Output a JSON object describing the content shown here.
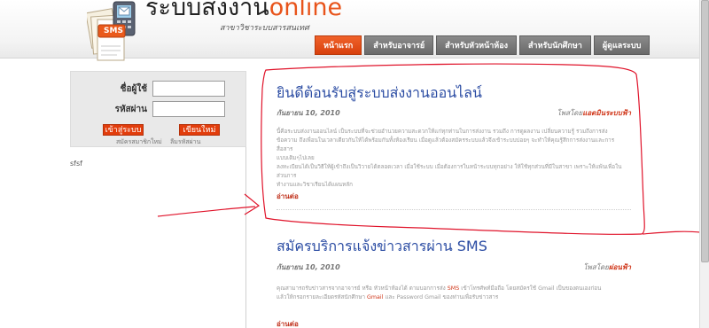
{
  "header": {
    "title_main": "ระบบส่งงาน",
    "title_accent": "online",
    "subtitle": "สาขาวิชาระบบสารสนเทศ",
    "logo_badge": "SMS"
  },
  "nav": {
    "items": [
      {
        "label": "หน้าแรก",
        "active": true
      },
      {
        "label": "สำหรับอาจารย์",
        "active": false
      },
      {
        "label": "สำหรับหัวหน้าห้อง",
        "active": false
      },
      {
        "label": "สำหรับนักศึกษา",
        "active": false
      },
      {
        "label": "ผู้ดูแลระบบ",
        "active": false
      }
    ]
  },
  "login": {
    "username_label": "ชื่อผู้ใช้",
    "username_value": "",
    "password_label": "รหัสผ่าน",
    "password_value": "",
    "login_button": "เข้าสู่ระบบ",
    "register_button": "เขียนใหม่",
    "signup_link": "สมัครสมาชิกใหม่",
    "forgot_link": "ลืมรหัสผ่าน"
  },
  "sidebar": {
    "extra_text": "sfsf"
  },
  "posts": [
    {
      "title": "ยินดีต้อนรับสู่ระบบส่งงานออนไลน์",
      "date": "กันยายน 10, 2010",
      "author_prefix": "โพสโดย",
      "author_name": "แอดมินระบบฟ้า",
      "body_line1": "นี้คือระบบส่งงานออนไลน์ เป็นระบบที่จะช่วยอำนวยความสะดวกให้แก่ทุกท่านในการส่งงาน รวมถึง การดูผลงาน เปลี่ยนความรู้ รวมถึงการส่ง",
      "body_line2": "ข้อความ ถึงเพื่อนในเวลาเดียวกันให้ได้พร้อมกันทั้งห้องเรียน เมื่อดูแล้วต้องสมัครระบบแล้วจึงเข้าระบบบ่อยๆ จะทำให้คุณรู้สึกการส่งงานและการสื่อสาร",
      "body_line3": "แบบเดิมๆไปเลย",
      "body_line4": "ลงทะเบียนได้เป็นวิธีให้ผู้เข้าถึงเป็นวิวายได้ตลอดเวลา เมื่อใช้ระบบ เมื่อต้องการในหน้าระบบทุกอย่าง ให้ใช้ทุกส่วนที่มีในสาขา เพราะให้แพ้นเพื่อในส่วนการ",
      "body_line5": "ทำงานและวิชาเรียนได้แผนหลัก",
      "read_more": "อ่านต่อ"
    },
    {
      "title": "สมัครบริการแจ้งข่าวสารผ่าน SMS",
      "date": "กันยายน 10, 2010",
      "author_prefix": "โพสโดย",
      "author_name": "ผ่อนฟ้า",
      "body_line1_a": "คุณสามารถรับข่าวสารจากอาจารย์ หรือ หัวหน้าห้องได้ ตามบอกการส่ง",
      "body_line1_hl": "SMS",
      "body_line1_b": "เข้าโทรศัพท์มือถือ โดยสมัครใช้ Gmail เป็นของตนเองก่อน",
      "body_line2_a": "แล้วให้กรอกรายละเอียดรหัสนักศึกษา",
      "body_line2_hl": "Gmail",
      "body_line2_b": "และ Password Gmail ของท่านเพื่อรับข่าวสาร",
      "read_more": "อ่านต่อ"
    }
  ],
  "colors": {
    "accent": "#e8541b",
    "nav_active": "#e0450f",
    "nav_inactive": "#7a7a7a",
    "post_title": "#2b4ca3",
    "annotation": "#e0132a"
  }
}
